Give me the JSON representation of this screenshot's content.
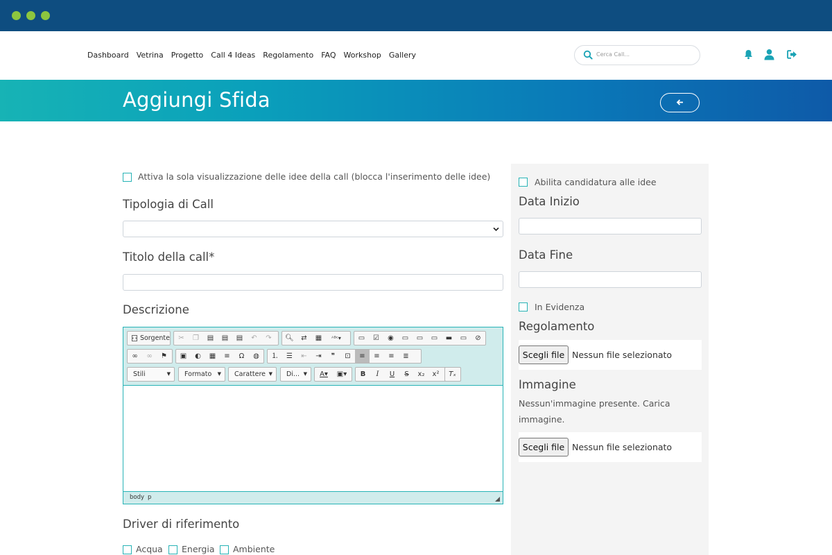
{
  "nav": {
    "menu": [
      "Dashboard",
      "Vetrina",
      "Progetto",
      "Call 4 Ideas",
      "Regolamento",
      "FAQ",
      "Workshop",
      "Gallery"
    ],
    "search_placeholder": "Cerca Call..."
  },
  "hero": {
    "title": "Aggiungi Sfida"
  },
  "form": {
    "view_only_label": "Attiva la sola visualizzazione delle idee della call (blocca l'inserimento delle idee)",
    "tipologia_label": "Tipologia di Call",
    "titolo_label": "Titolo della call*",
    "descrizione_label": "Descrizione",
    "driver_label": "Driver di riferimento",
    "drivers": [
      "Acqua",
      "Energia",
      "Ambiente"
    ]
  },
  "editor": {
    "source_label": "Sorgente",
    "combos": [
      "Stili",
      "Formato",
      "Carattere",
      "Di..."
    ],
    "path": [
      "body",
      "p"
    ]
  },
  "side": {
    "abilita_label": "Abilita candidatura alle idee",
    "data_inizio_label": "Data Inizio",
    "data_fine_label": "Data Fine",
    "evidenza_label": "In Evidenza",
    "regolamento_label": "Regolamento",
    "file_button": "Scegli file",
    "no_file": "Nessun file selezionato",
    "immagine_label": "Immagine",
    "no_image_line1": "Nessun'immagine presente. Carica",
    "no_image_line2": "immagine."
  },
  "colors": {
    "chrome": "#0e4d80",
    "accent": "#27b3b6",
    "dot": "#8cc63f"
  }
}
